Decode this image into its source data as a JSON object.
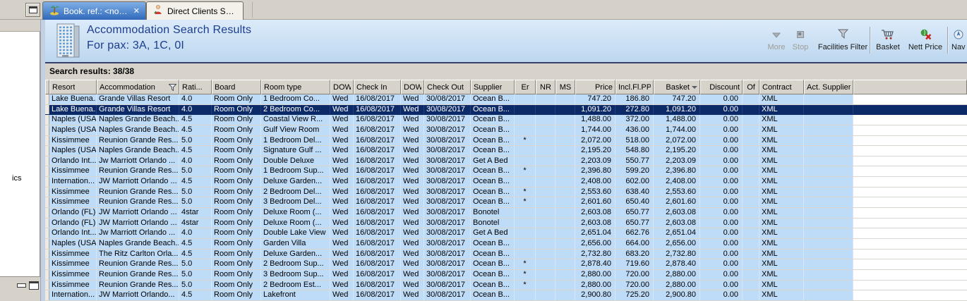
{
  "tabs": [
    {
      "label": "Book. ref.: <none>",
      "active": true,
      "closable": true
    },
    {
      "label": "Direct Clients Search",
      "active": false,
      "closable": false
    }
  ],
  "sidebar": {
    "partial_text": "ics"
  },
  "header": {
    "title": "Accommodation Search Results",
    "subtitle": "For pax: 3A, 1C, 0I"
  },
  "toolbar": [
    {
      "label": "More",
      "disabled": true,
      "icon": "more-arrow-icon"
    },
    {
      "label": "Stop",
      "disabled": true,
      "icon": "stop-icon"
    },
    {
      "label": "Facilities Filter",
      "disabled": false,
      "icon": "funnel-icon"
    },
    {
      "label": "Basket",
      "disabled": false,
      "icon": "basket-cart-icon"
    },
    {
      "label": "Nett Price",
      "disabled": false,
      "icon": "nett-price-icon"
    },
    {
      "label": "Nav",
      "disabled": false,
      "icon": "navigate-icon",
      "truncated": true
    }
  ],
  "results_bar": "Search results: 38/38",
  "table": {
    "columns": {
      "resort": "Resort",
      "accommodation": "Accommodation",
      "rating": "Rati...",
      "board": "Board",
      "room_type": "Room type",
      "dow_in": "DOW",
      "check_in": "Check In",
      "dow_out": "DOW",
      "check_out": "Check Out",
      "supplier": "Supplier",
      "er": "Er",
      "nr": "NR",
      "ms": "MS",
      "price": "Price",
      "incl_fl_pp": "Incl.Fl.PP",
      "basket": "Basket",
      "discount": "Discount",
      "of": "Of",
      "contract": "Contract",
      "act_supplier": "Act. Supplier"
    },
    "selected_row_index": 1,
    "rows": [
      [
        "Lake Buena...",
        "Grande Villas Resort",
        "4.0",
        "Room Only",
        "1 Bedroom Co...",
        "Wed",
        "16/08/2017",
        "Wed",
        "30/08/2017",
        "Ocean B...",
        "",
        "",
        "",
        "747.20",
        "186.80",
        "747.20",
        "0.00",
        "",
        "XML",
        ""
      ],
      [
        "Lake Buena...",
        "Grande Villas Resort",
        "4.0",
        "Room Only",
        "2 Bedroom Co...",
        "Wed",
        "16/08/2017",
        "Wed",
        "30/08/2017",
        "Ocean B...",
        "",
        "",
        "",
        "1,091.20",
        "272.80",
        "1,091.20",
        "0.00",
        "",
        "XML",
        ""
      ],
      [
        "Naples (USA)",
        "Naples Grande Beach...",
        "4.5",
        "Room Only",
        "Coastal View R...",
        "Wed",
        "16/08/2017",
        "Wed",
        "30/08/2017",
        "Ocean B...",
        "",
        "",
        "",
        "1,488.00",
        "372.00",
        "1,488.00",
        "0.00",
        "",
        "XML",
        ""
      ],
      [
        "Naples (USA)",
        "Naples Grande Beach...",
        "4.5",
        "Room Only",
        "Gulf View Room",
        "Wed",
        "16/08/2017",
        "Wed",
        "30/08/2017",
        "Ocean B...",
        "",
        "",
        "",
        "1,744.00",
        "436.00",
        "1,744.00",
        "0.00",
        "",
        "XML",
        ""
      ],
      [
        "Kissimmee",
        "Reunion Grande Res...",
        "5.0",
        "Room Only",
        "1 Bedroom Del...",
        "Wed",
        "16/08/2017",
        "Wed",
        "30/08/2017",
        "Ocean B...",
        "*",
        "",
        "",
        "2,072.00",
        "518.00",
        "2,072.00",
        "0.00",
        "",
        "XML",
        ""
      ],
      [
        "Naples (USA)",
        "Naples Grande Beach...",
        "4.5",
        "Room Only",
        "Signature Gulf ...",
        "Wed",
        "16/08/2017",
        "Wed",
        "30/08/2017",
        "Ocean B...",
        "",
        "",
        "",
        "2,195.20",
        "548.80",
        "2,195.20",
        "0.00",
        "",
        "XML",
        ""
      ],
      [
        "Orlando Int...",
        "Jw Marriott Orlando ...",
        "4.0",
        "Room Only",
        "Double Deluxe",
        "Wed",
        "16/08/2017",
        "Wed",
        "30/08/2017",
        "Get A Bed",
        "",
        "",
        "",
        "2,203.09",
        "550.77",
        "2,203.09",
        "0.00",
        "",
        "XML",
        ""
      ],
      [
        "Kissimmee",
        "Reunion Grande Res...",
        "5.0",
        "Room Only",
        "1 Bedroom Sup...",
        "Wed",
        "16/08/2017",
        "Wed",
        "30/08/2017",
        "Ocean B...",
        "*",
        "",
        "",
        "2,396.80",
        "599.20",
        "2,396.80",
        "0.00",
        "",
        "XML",
        ""
      ],
      [
        "Internation...",
        "JW Marriott Orlando ...",
        "4.5",
        "Room Only",
        "Deluxe Garden...",
        "Wed",
        "16/08/2017",
        "Wed",
        "30/08/2017",
        "Ocean B...",
        "",
        "",
        "",
        "2,408.00",
        "602.00",
        "2,408.00",
        "0.00",
        "",
        "XML",
        ""
      ],
      [
        "Kissimmee",
        "Reunion Grande Res...",
        "5.0",
        "Room Only",
        "2 Bedroom Del...",
        "Wed",
        "16/08/2017",
        "Wed",
        "30/08/2017",
        "Ocean B...",
        "*",
        "",
        "",
        "2,553.60",
        "638.40",
        "2,553.60",
        "0.00",
        "",
        "XML",
        ""
      ],
      [
        "Kissimmee",
        "Reunion Grande Res...",
        "5.0",
        "Room Only",
        "3 Bedroom Del...",
        "Wed",
        "16/08/2017",
        "Wed",
        "30/08/2017",
        "Ocean B...",
        "*",
        "",
        "",
        "2,601.60",
        "650.40",
        "2,601.60",
        "0.00",
        "",
        "XML",
        ""
      ],
      [
        "Orlando (FL)",
        "JW Marriott Orlando ...",
        "4star",
        "Room Only",
        "Deluxe Room (...",
        "Wed",
        "16/08/2017",
        "Wed",
        "30/08/2017",
        "Bonotel",
        "",
        "",
        "",
        "2,603.08",
        "650.77",
        "2,603.08",
        "0.00",
        "",
        "XML",
        ""
      ],
      [
        "Orlando (FL)",
        "JW Marriott Orlando ...",
        "4star",
        "Room Only",
        "Deluxe Room (...",
        "Wed",
        "16/08/2017",
        "Wed",
        "30/08/2017",
        "Bonotel",
        "",
        "",
        "",
        "2,603.08",
        "650.77",
        "2,603.08",
        "0.00",
        "",
        "XML",
        ""
      ],
      [
        "Orlando Int...",
        "Jw Marriott Orlando ...",
        "4.0",
        "Room Only",
        "Double Lake View",
        "Wed",
        "16/08/2017",
        "Wed",
        "30/08/2017",
        "Get A Bed",
        "",
        "",
        "",
        "2,651.04",
        "662.76",
        "2,651.04",
        "0.00",
        "",
        "XML",
        ""
      ],
      [
        "Naples (USA)",
        "Naples Grande Beach...",
        "4.5",
        "Room Only",
        "Garden Villa",
        "Wed",
        "16/08/2017",
        "Wed",
        "30/08/2017",
        "Ocean B...",
        "",
        "",
        "",
        "2,656.00",
        "664.00",
        "2,656.00",
        "0.00",
        "",
        "XML",
        ""
      ],
      [
        "Kissimmee",
        "The Ritz Carlton Orla...",
        "4.5",
        "Room Only",
        "Deluxe Garden...",
        "Wed",
        "16/08/2017",
        "Wed",
        "30/08/2017",
        "Ocean B...",
        "",
        "",
        "",
        "2,732.80",
        "683.20",
        "2,732.80",
        "0.00",
        "",
        "XML",
        ""
      ],
      [
        "Kissimmee",
        "Reunion Grande Res...",
        "5.0",
        "Room Only",
        "2 Bedroom Sup...",
        "Wed",
        "16/08/2017",
        "Wed",
        "30/08/2017",
        "Ocean B...",
        "*",
        "",
        "",
        "2,878.40",
        "719.60",
        "2,878.40",
        "0.00",
        "",
        "XML",
        ""
      ],
      [
        "Kissimmee",
        "Reunion Grande Res...",
        "5.0",
        "Room Only",
        "3 Bedroom Sup...",
        "Wed",
        "16/08/2017",
        "Wed",
        "30/08/2017",
        "Ocean B...",
        "*",
        "",
        "",
        "2,880.00",
        "720.00",
        "2,880.00",
        "0.00",
        "",
        "XML",
        ""
      ],
      [
        "Kissimmee",
        "Reunion Grande Res...",
        "5.0",
        "Room Only",
        "2 Bedroom Est...",
        "Wed",
        "16/08/2017",
        "Wed",
        "30/08/2017",
        "Ocean B...",
        "*",
        "",
        "",
        "2,880.00",
        "720.00",
        "2,880.00",
        "0.00",
        "",
        "XML",
        ""
      ],
      [
        "Internation...",
        "JW Marriott Orlando...",
        "4.5",
        "Room Only",
        "Lakefront",
        "Wed",
        "16/08/2017",
        "Wed",
        "30/08/2017",
        "Ocean B...",
        "",
        "",
        "",
        "2,900.80",
        "725.20",
        "2,900.80",
        "0.00",
        "",
        "XML",
        ""
      ]
    ]
  },
  "colors": {
    "selected_row": "#0c2a68",
    "row_bg": "#bedbf8",
    "header_gray": "#d7d3cb",
    "band_top": "#dcebfa",
    "band_bottom": "#bdd7ef",
    "title_text": "#1b3d8f",
    "tab_active_top": "#7fb0e6",
    "tab_active_bottom": "#2f68ba"
  }
}
